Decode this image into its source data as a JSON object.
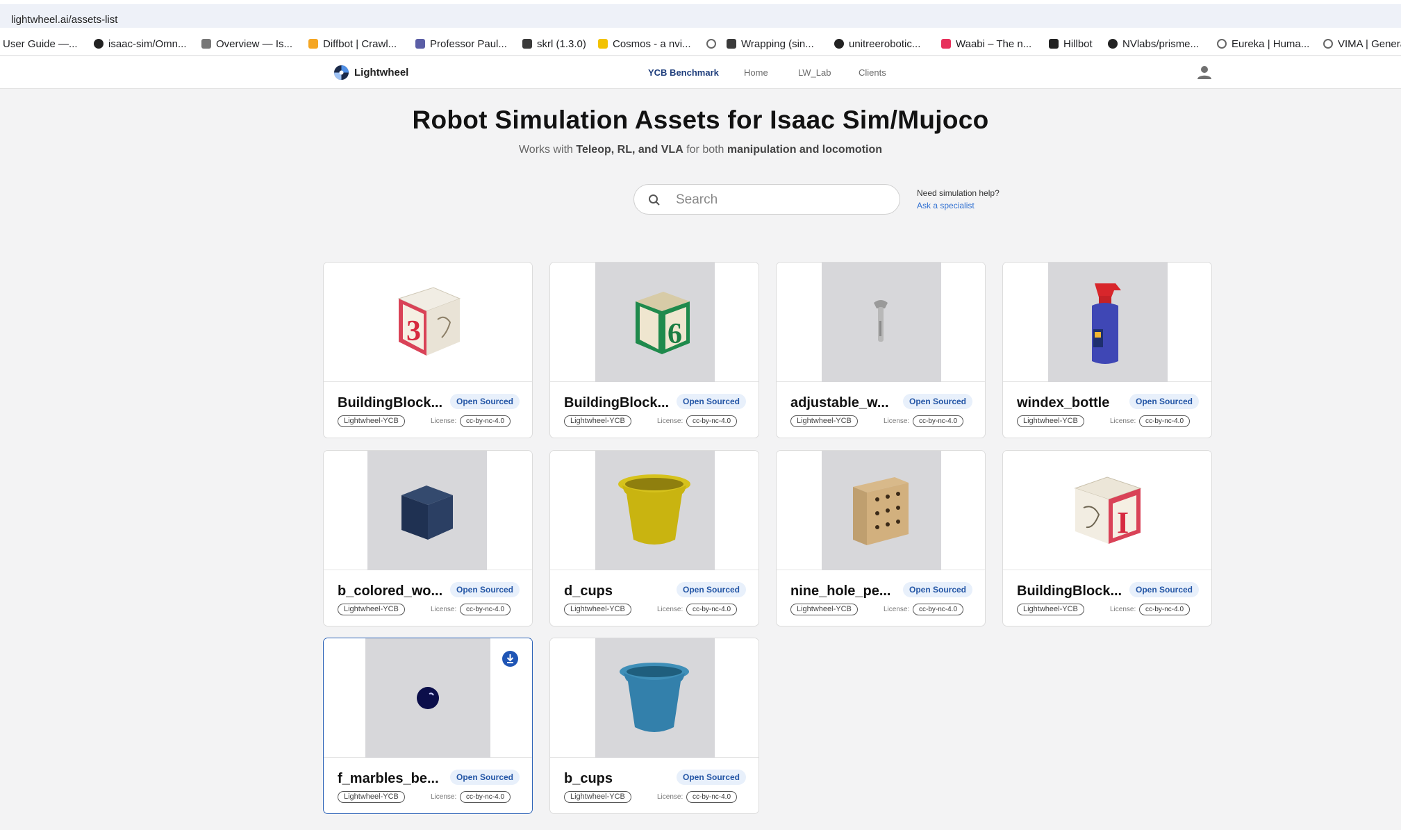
{
  "browser": {
    "url": "lightwheel.ai/assets-list",
    "bookmarks": [
      {
        "label": "User Guide —...",
        "icon": "doc-icon",
        "color": "#ffffff"
      },
      {
        "label": "isaac-sim/Omn...",
        "icon": "github-icon",
        "color": "#222222"
      },
      {
        "label": "Overview — Is...",
        "icon": "page-icon",
        "color": "#777777"
      },
      {
        "label": "Diffbot | Crawl...",
        "icon": "diffbot-icon",
        "color": "#f5a623"
      },
      {
        "label": "Professor Paul...",
        "icon": "shield-icon",
        "color": "#5b5ea6"
      },
      {
        "label": "skrl (1.3.0)",
        "icon": "skrl-icon",
        "color": "#3a3a3a"
      },
      {
        "label": "Cosmos - a nvi...",
        "icon": "cosmos-icon",
        "color": "#f2c200"
      },
      {
        "label": "",
        "icon": "globe-icon",
        "color": "#666666"
      },
      {
        "label": "Wrapping (sin...",
        "icon": "skrl-icon",
        "color": "#3a3a3a"
      },
      {
        "label": "unitreerobotic...",
        "icon": "github-icon",
        "color": "#222222"
      },
      {
        "label": "Waabi – The n...",
        "icon": "waabi-icon",
        "color": "#e7305b"
      },
      {
        "label": "Hillbot",
        "icon": "hillbot-icon",
        "color": "#222222"
      },
      {
        "label": "NVlabs/prisme...",
        "icon": "github-icon",
        "color": "#222222"
      },
      {
        "label": "Eureka | Huma...",
        "icon": "globe-icon",
        "color": "#666666"
      },
      {
        "label": "VIMA | Genera...",
        "icon": "globe-icon",
        "color": "#666666"
      }
    ]
  },
  "header": {
    "brand": "Lightwheel",
    "nav": [
      "YCB Benchmark",
      "Home",
      "LW_Lab",
      "Clients"
    ],
    "active_nav": "YCB Benchmark"
  },
  "hero": {
    "title": "Robot Simulation Assets for Isaac Sim/Mujoco",
    "sub_prefix": "Works with ",
    "sub_bold1": "Teleop, RL, and VLA",
    "sub_mid": " for both ",
    "sub_bold2": "manipulation and locomotion"
  },
  "search": {
    "placeholder": "Search"
  },
  "help": {
    "question": "Need simulation help?",
    "link": "Ask a specialist"
  },
  "cards": [
    {
      "name": "BuildingBlock...",
      "badge": "Open Sourced",
      "tag": "Lightwheel-YCB",
      "license_label": "License:",
      "license": "cc-by-nc-4.0",
      "object": "block-3"
    },
    {
      "name": "BuildingBlock...",
      "badge": "Open Sourced",
      "tag": "Lightwheel-YCB",
      "license_label": "License:",
      "license": "cc-by-nc-4.0",
      "object": "block-6"
    },
    {
      "name": "adjustable_w...",
      "badge": "Open Sourced",
      "tag": "Lightwheel-YCB",
      "license_label": "License:",
      "license": "cc-by-nc-4.0",
      "object": "wrench"
    },
    {
      "name": "windex_bottle",
      "badge": "Open Sourced",
      "tag": "Lightwheel-YCB",
      "license_label": "License:",
      "license": "cc-by-nc-4.0",
      "object": "spray-bottle"
    },
    {
      "name": "b_colored_wo...",
      "badge": "Open Sourced",
      "tag": "Lightwheel-YCB",
      "license_label": "License:",
      "license": "cc-by-nc-4.0",
      "object": "navy-cube"
    },
    {
      "name": "d_cups",
      "badge": "Open Sourced",
      "tag": "Lightwheel-YCB",
      "license_label": "License:",
      "license": "cc-by-nc-4.0",
      "object": "yellow-cup"
    },
    {
      "name": "nine_hole_pe...",
      "badge": "Open Sourced",
      "tag": "Lightwheel-YCB",
      "license_label": "License:",
      "license": "cc-by-nc-4.0",
      "object": "peg-board"
    },
    {
      "name": "BuildingBlock...",
      "badge": "Open Sourced",
      "tag": "Lightwheel-YCB",
      "license_label": "License:",
      "license": "cc-by-nc-4.0",
      "object": "block-i"
    },
    {
      "name": "f_marbles_be...",
      "badge": "Open Sourced",
      "tag": "Lightwheel-YCB",
      "license_label": "License:",
      "license": "cc-by-nc-4.0",
      "object": "marble",
      "selected": true
    },
    {
      "name": "b_cups",
      "badge": "Open Sourced",
      "tag": "Lightwheel-YCB",
      "license_label": "License:",
      "license": "cc-by-nc-4.0",
      "object": "blue-cup"
    }
  ],
  "colors": {
    "accent": "#2456a6",
    "nav_active": "#1f3e7c",
    "link": "#2f6fd1",
    "stage": "#d7d7da"
  }
}
